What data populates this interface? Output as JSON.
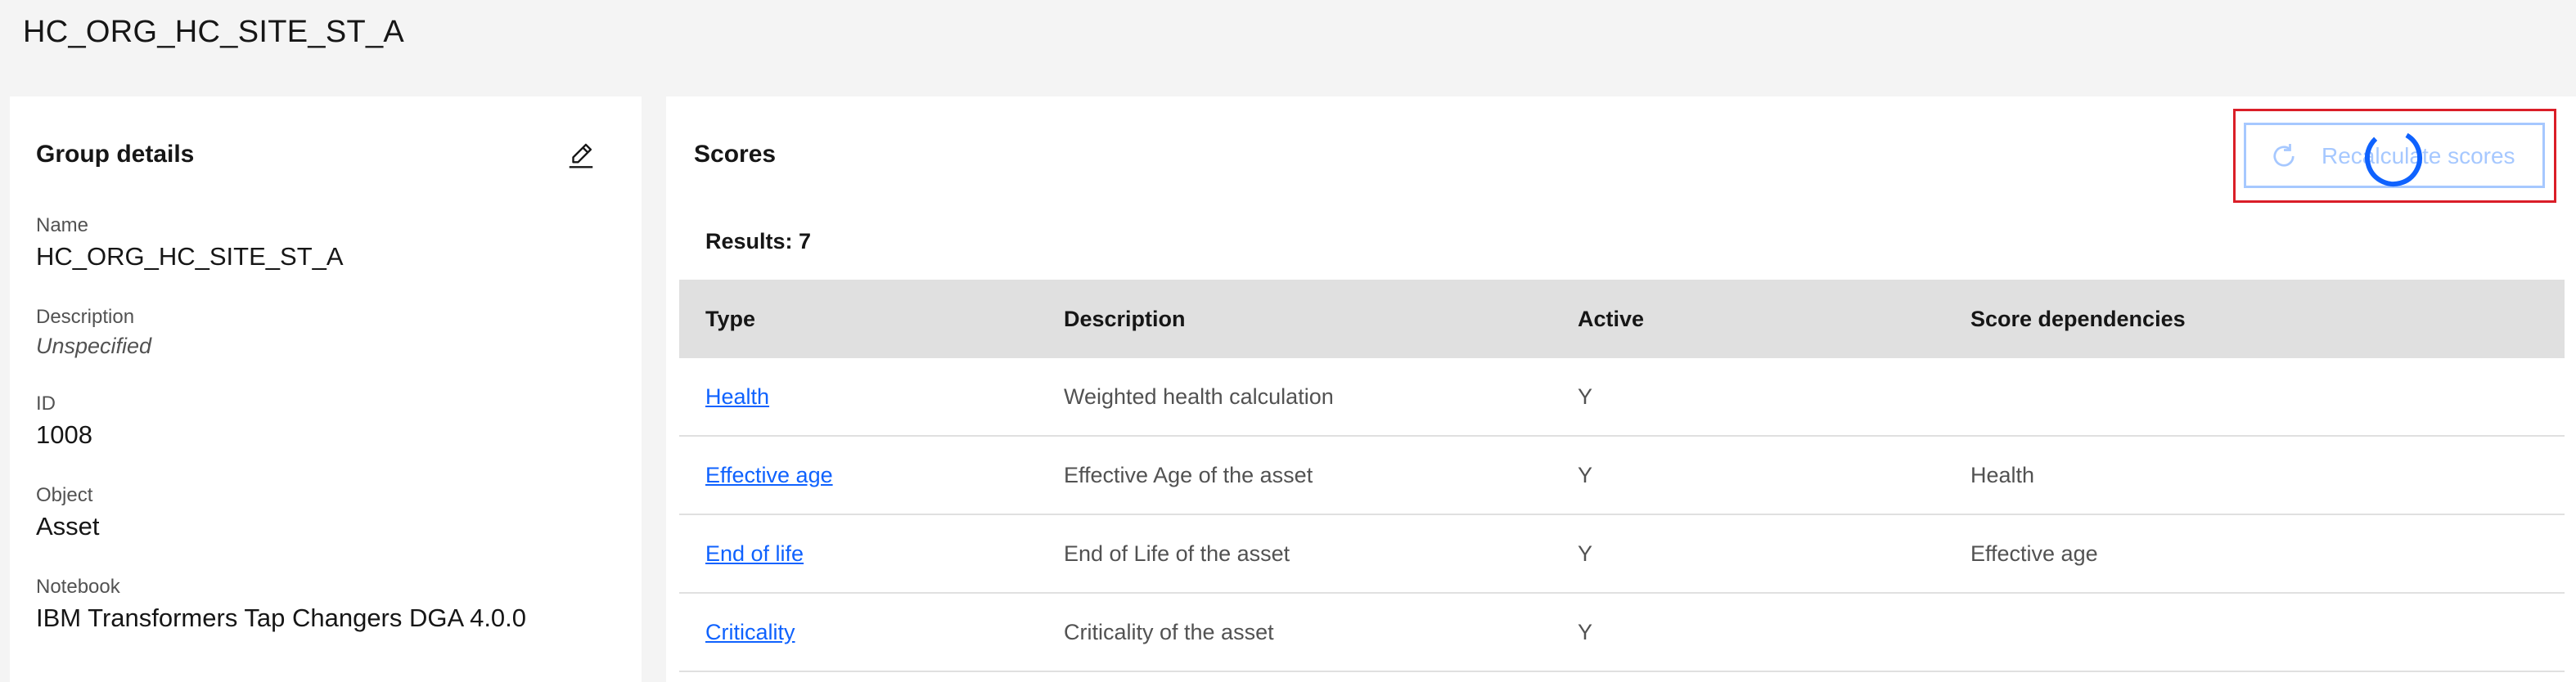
{
  "page": {
    "title": "HC_ORG_HC_SITE_ST_A"
  },
  "group_details": {
    "heading": "Group details",
    "fields": [
      {
        "label": "Name",
        "value": "HC_ORG_HC_SITE_ST_A"
      },
      {
        "label": "Description",
        "value": "Unspecified"
      },
      {
        "label": "ID",
        "value": "1008"
      },
      {
        "label": "Object",
        "value": "Asset"
      },
      {
        "label": "Notebook",
        "value": "IBM Transformers Tap Changers DGA 4.0.0"
      }
    ],
    "edit_icon": "pencil-icon"
  },
  "scores": {
    "heading": "Scores",
    "recalculate_label": "Recalculate scores",
    "refresh_icon": "refresh-icon",
    "results": "Results: 7",
    "columns": [
      "Type",
      "Description",
      "Active",
      "Score dependencies"
    ],
    "rows": [
      {
        "type": "Health",
        "description": "Weighted health calculation",
        "active": "Y",
        "dependencies": ""
      },
      {
        "type": "Effective age",
        "description": "Effective Age of the asset",
        "active": "Y",
        "dependencies": "Health"
      },
      {
        "type": "End of life",
        "description": "End of Life of the asset",
        "active": "Y",
        "dependencies": "Effective age"
      },
      {
        "type": "Criticality",
        "description": "Criticality of the asset",
        "active": "Y",
        "dependencies": ""
      }
    ]
  },
  "colors": {
    "link": "#0f62fe",
    "highlight": "#da1e28",
    "disabled_button": "#a6c8ff",
    "spinner": "#0f62fe",
    "background": "#f4f4f4"
  }
}
